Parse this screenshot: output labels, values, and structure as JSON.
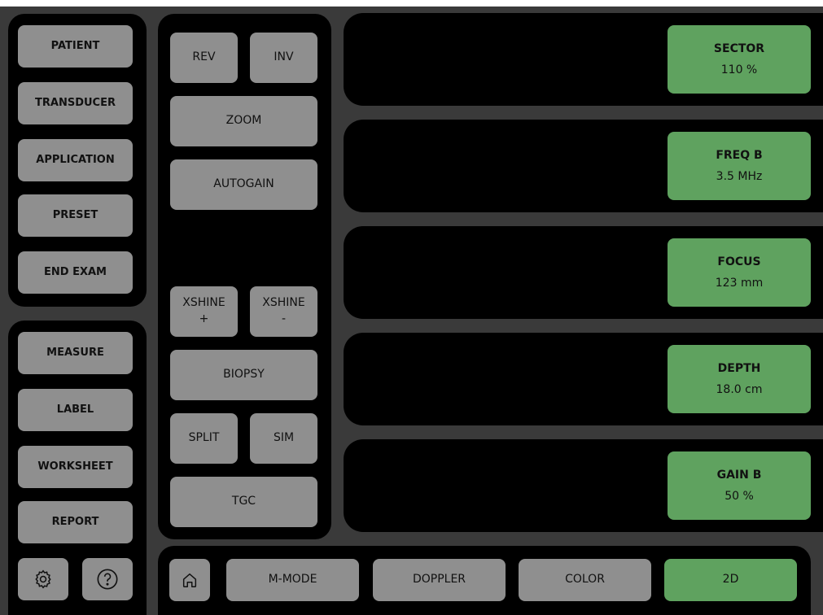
{
  "left_top": [
    "PATIENT",
    "TRANSDUCER",
    "APPLICATION",
    "PRESET",
    "END EXAM"
  ],
  "left_bottom": [
    "MEASURE",
    "LABEL",
    "WORKSHEET",
    "REPORT"
  ],
  "mid": {
    "rev": "REV",
    "inv": "INV",
    "zoom": "ZOOM",
    "autogain": "AUTOGAIN",
    "xshine_plus": "XSHINE\n+",
    "xshine_minus": "XSHINE\n-",
    "biopsy": "BIOPSY",
    "split": "SPLIT",
    "sim": "SIM",
    "tgc": "TGC"
  },
  "params": [
    {
      "title": "SECTOR",
      "value": "110 %"
    },
    {
      "title": "FREQ B",
      "value": "3.5 MHz"
    },
    {
      "title": "FOCUS",
      "value": "123 mm"
    },
    {
      "title": "DEPTH",
      "value": "18.0 cm"
    },
    {
      "title": "GAIN B",
      "value": "50 %"
    }
  ],
  "bottom": {
    "mmode": "M-MODE",
    "doppler": "DOPPLER",
    "color": "COLOR",
    "twod": "2D"
  },
  "icons": {
    "settings": "gear-icon",
    "help": "help-icon",
    "home": "home-icon"
  },
  "colors": {
    "button": "#8f8f8f",
    "active": "#5fa25f",
    "panel": "#000000",
    "background": "#3a3a3a"
  }
}
